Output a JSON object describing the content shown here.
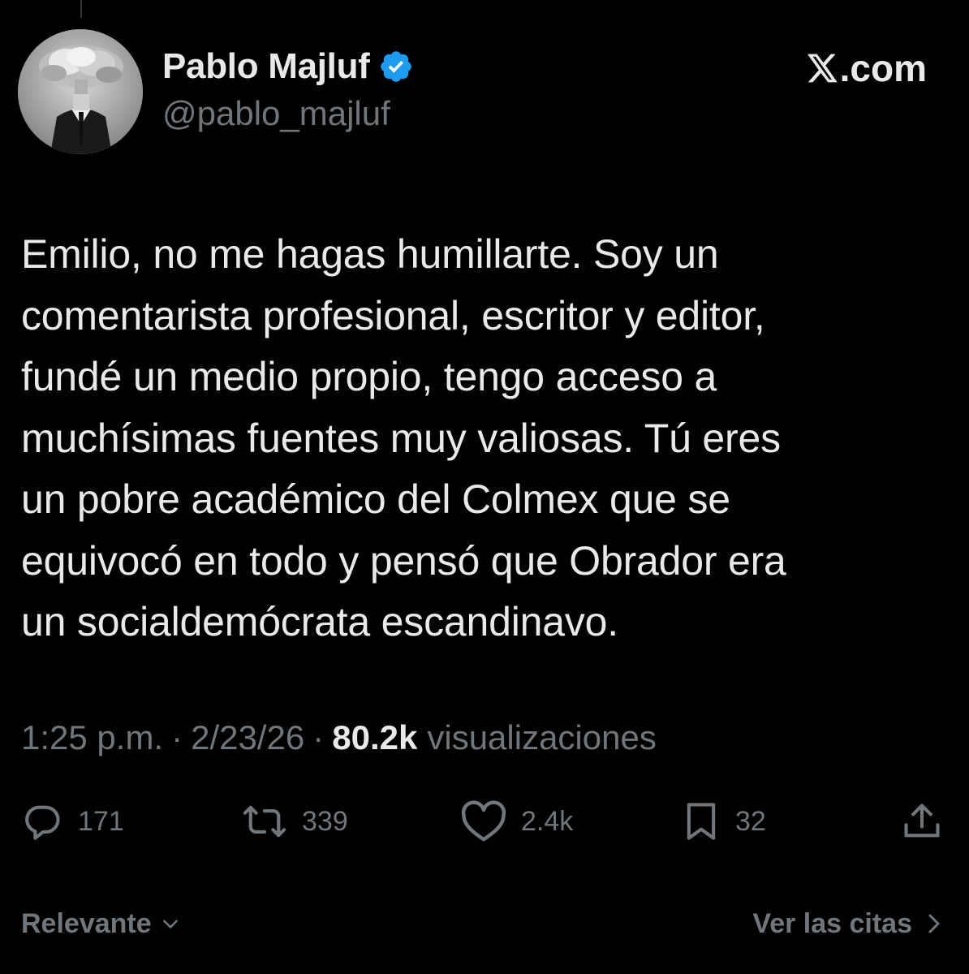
{
  "author": {
    "display_name": "Pablo Majluf",
    "handle": "@pablo_majluf",
    "verified": true,
    "verified_color": "#1d9bf0"
  },
  "brand": {
    "label": ".com",
    "icon": "x-logo-icon"
  },
  "tweet": {
    "lines": [
      "Emilio, no me hagas humillarte. Soy un",
      "comentarista profesional, escritor y editor,",
      "fundé un medio propio, tengo acceso a",
      "muchísimas fuentes muy valiosas. Tú eres",
      "un pobre académico del Colmex que se",
      "equivocó en todo y pensó que Obrador era",
      "un socialdemócrata escandinavo."
    ]
  },
  "meta": {
    "time": "1:25 p.m.",
    "separator": "·",
    "date": "2/23/26",
    "views_count": "80.2k",
    "views_label": "visualizaciones"
  },
  "actions": {
    "replies": {
      "count": "171",
      "icon": "reply-icon"
    },
    "reposts": {
      "count": "339",
      "icon": "repost-icon"
    },
    "likes": {
      "count": "2.4k",
      "icon": "heart-icon"
    },
    "bookmarks": {
      "count": "32",
      "icon": "bookmark-icon"
    },
    "share": {
      "icon": "share-icon"
    }
  },
  "footer": {
    "sort_label": "Relevante",
    "quotes_label": "Ver las citas"
  },
  "colors": {
    "background": "#000000",
    "primary_text": "#e7e9ea",
    "secondary_text": "#71767b"
  }
}
